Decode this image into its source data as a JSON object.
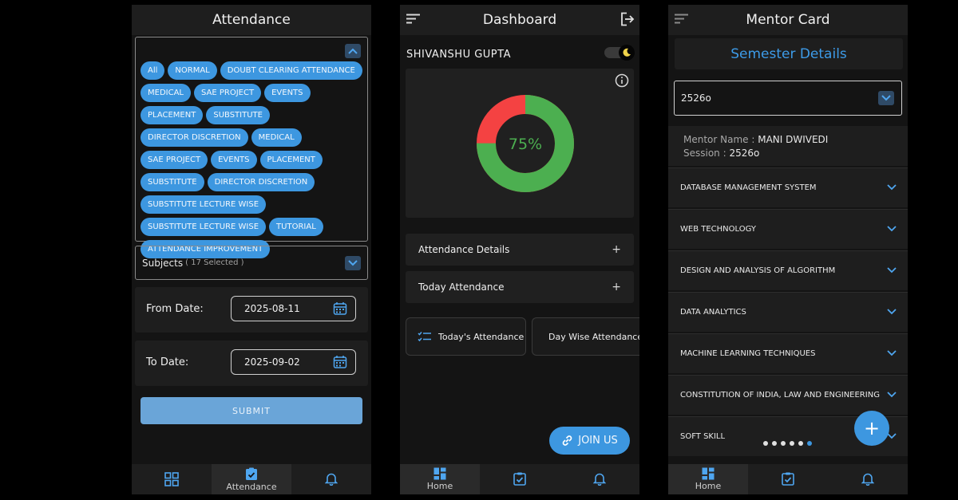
{
  "attendance": {
    "title": "Attendance",
    "chips": [
      "All",
      "NORMAL",
      "DOUBT CLEARING ATTENDANCE",
      "MEDICAL",
      "SAE PROJECT",
      "EVENTS",
      "PLACEMENT",
      "SUBSTITUTE",
      "DIRECTOR DISCRETION",
      "MEDICAL",
      "SAE PROJECT",
      "EVENTS",
      "PLACEMENT",
      "SUBSTITUTE",
      "DIRECTOR DISCRETION",
      "SUBSTITUTE LECTURE WISE",
      "SUBSTITUTE LECTURE WISE",
      "TUTORIAL",
      "ATTENDANCE IMPROVEMENT"
    ],
    "subjects_label": "Subjects",
    "subjects_selected": "( 17 Selected )",
    "from_label": "From Date:",
    "from_value": "2025-08-11",
    "to_label": "To Date:",
    "to_value": "2025-09-02",
    "submit_label": "SUBMIT",
    "nav_attendance_label": "Attendance"
  },
  "dashboard": {
    "title": "Dashboard",
    "user_name": "SHIVANSHU GUPTA",
    "percent_text": "75%",
    "percent": 75,
    "accordion": [
      "Attendance Details",
      "Today Attendance"
    ],
    "todays_attendance_label": "Today's Attendance",
    "day_wise_label": "Day Wise Attendance",
    "join_label": "JOIN US",
    "nav_home_label": "Home",
    "colors": {
      "present": "#4caf50",
      "absent": "#f44242",
      "accent": "#3d97e0"
    }
  },
  "mentor": {
    "title": "Mentor Card",
    "semester_label": "Semester Details",
    "semester_value": "2526o",
    "mentor_name_key": "Mentor Name : ",
    "mentor_name": "MANI DWIVEDI",
    "session_key": "Session : ",
    "session_value": "2526o",
    "subjects": [
      "DATABASE MANAGEMENT SYSTEM",
      "WEB TECHNOLOGY",
      "DESIGN AND ANALYSIS OF ALGORITHM",
      "DATA ANALYTICS",
      "MACHINE LEARNING TECHNIQUES",
      "CONSTITUTION OF INDIA, LAW AND ENGINEERING",
      "SOFT SKILL"
    ],
    "fab_label": "+",
    "nav_home_label": "Home"
  }
}
